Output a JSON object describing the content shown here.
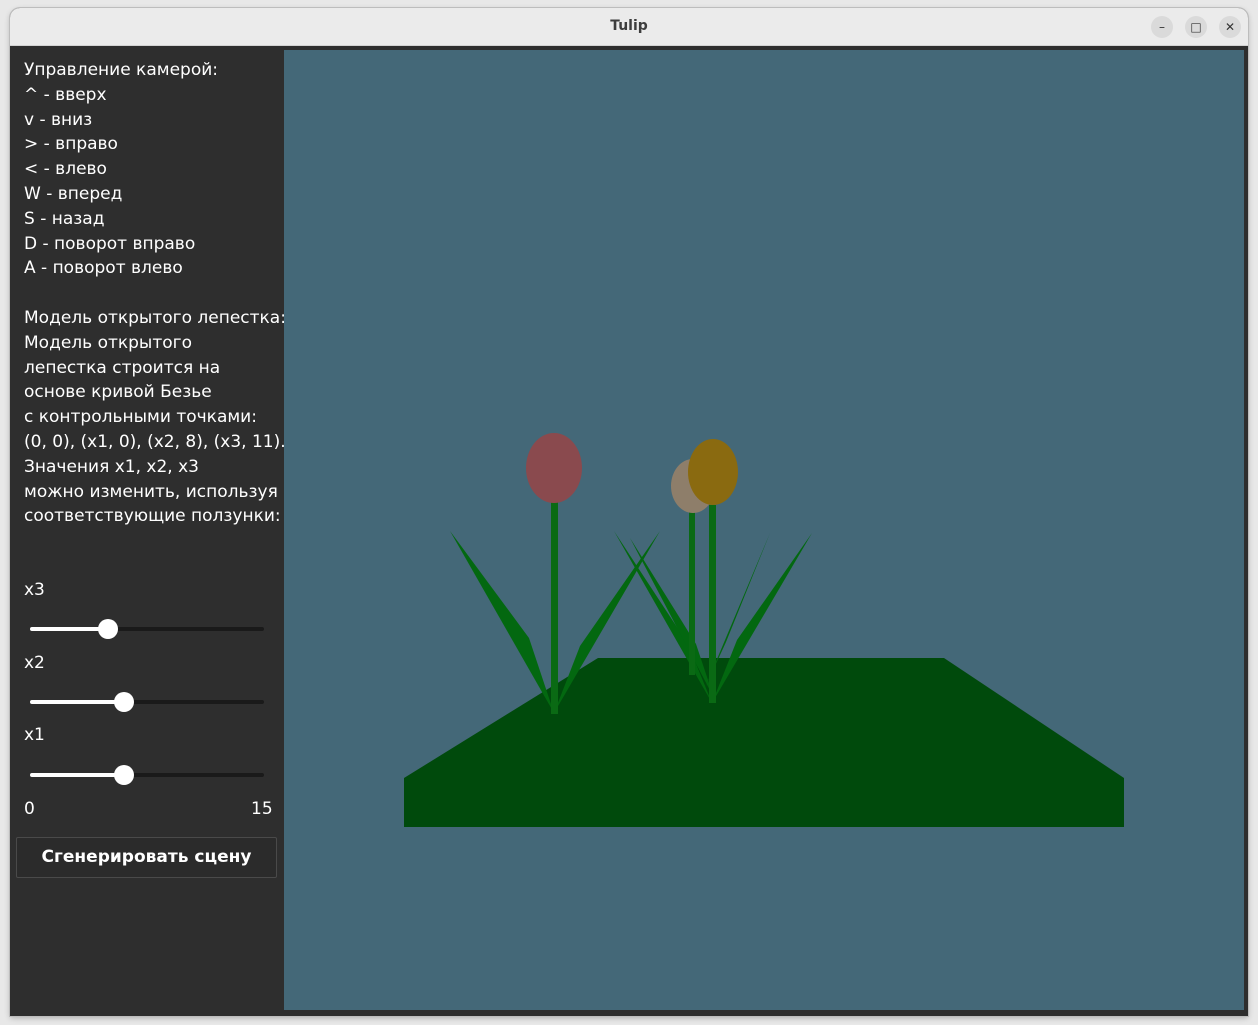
{
  "window": {
    "title": "Tulip",
    "controls": {
      "minimize": "–",
      "maximize": "□",
      "close": "✕"
    }
  },
  "sidebar": {
    "info_lines": [
      "Управление камерой:",
      "^ - вверх",
      "v - вниз",
      "> - вправо",
      "< - влево",
      "W - вперед",
      "S - назад",
      "D - поворот вправо",
      "A - поворот влево",
      "",
      "Модель открытого лепестка:",
      "Модель открытого",
      "лепестка строится на",
      "основе кривой Безье",
      "с контрольными точками:",
      "(0, 0), (x1, 0), (x2, 8), (x3, 11).",
      "Значения x1, x2, x3",
      "можно изменить, используя",
      "соответствующие ползунки:"
    ],
    "sliders": [
      {
        "label": "x3",
        "value": 5
      },
      {
        "label": "x2",
        "value": 6
      },
      {
        "label": "x1",
        "value": 6
      }
    ],
    "range": {
      "min": "0",
      "max": "15"
    },
    "generate_button": "Сгенерировать сцену"
  },
  "scene": {
    "background": "#446878",
    "ground_color": "#004a0c",
    "leaf_color": "#036810",
    "stem_color": "#0a6a14",
    "flower_colors": [
      "#8a4a4e",
      "#8e7e6a",
      "#8a6a10"
    ]
  }
}
